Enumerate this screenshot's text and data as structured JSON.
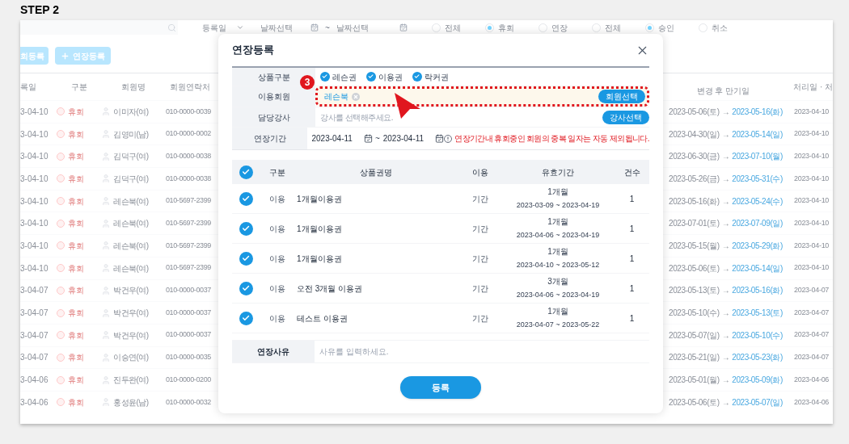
{
  "heading": "STEP 2",
  "background": {
    "filter": {
      "date_type": "등록일",
      "date_from": "날짜선택",
      "separator": "~",
      "date_to": "날짜선택"
    },
    "radio_groups": [
      [
        {
          "label": "전체",
          "selected": false
        },
        {
          "label": "휴회",
          "selected": true
        },
        {
          "label": "연장",
          "selected": false
        }
      ],
      [
        {
          "label": "전체",
          "selected": false
        },
        {
          "label": "승인",
          "selected": true
        },
        {
          "label": "취소",
          "selected": false
        }
      ]
    ],
    "actions": [
      {
        "kind": "plain",
        "label": "회등록"
      },
      {
        "kind": "add",
        "label": "연장등록"
      }
    ],
    "columns_left": [
      "록일",
      "구분",
      "회원명",
      "회원연락처"
    ],
    "columns_right": [
      "변경 후 만기일",
      "처리일 · 처"
    ],
    "rows": [
      {
        "date": "3-04-10",
        "status": "휴회",
        "name": "이미자",
        "gender": "(여)",
        "phone": "010-0000-0039",
        "before": "2023-05-06(토)",
        "arrow": "→",
        "after": "2023-05-16(화)",
        "processed": "2023-04-10"
      },
      {
        "date": "3-04-10",
        "status": "휴회",
        "name": "김영미",
        "gender": "(남)",
        "phone": "010-0000-0002",
        "before": "2023-04-30(일)",
        "arrow": "→",
        "after": "2023-05-14(일)",
        "processed": "2023-04-10"
      },
      {
        "date": "3-04-10",
        "status": "휴회",
        "name": "김덕구",
        "gender": "(여)",
        "phone": "010-0000-0038",
        "before": "2023-06-30(금)",
        "arrow": "→",
        "after": "2023-07-10(월)",
        "processed": "2023-04-10"
      },
      {
        "date": "3-04-10",
        "status": "휴회",
        "name": "김덕구",
        "gender": "(여)",
        "phone": "010-0000-0038",
        "before": "2023-05-26(금)",
        "arrow": "→",
        "after": "2023-05-31(수)",
        "processed": "2023-04-10"
      },
      {
        "date": "3-04-10",
        "status": "휴회",
        "name": "레슨북",
        "gender": "(여)",
        "phone": "010-5697-2399",
        "before": "2023-05-16(화)",
        "arrow": "→",
        "after": "2023-05-24(수)",
        "processed": "2023-04-10"
      },
      {
        "date": "3-04-10",
        "status": "휴회",
        "name": "레슨북",
        "gender": "(여)",
        "phone": "010-5697-2399",
        "before": "2023-07-01(토)",
        "arrow": "→",
        "after": "2023-07-09(일)",
        "processed": "2023-04-10"
      },
      {
        "date": "3-04-10",
        "status": "휴회",
        "name": "레슨북",
        "gender": "(여)",
        "phone": "010-5697-2399",
        "before": "2023-05-15(월)",
        "arrow": "→",
        "after": "2023-05-29(화)",
        "processed": "2023-04-10"
      },
      {
        "date": "3-04-10",
        "status": "휴회",
        "name": "레슨북",
        "gender": "(여)",
        "phone": "010-5697-2399",
        "before": "2023-05-06(토)",
        "arrow": "→",
        "after": "2023-05-14(일)",
        "processed": "2023-04-10"
      },
      {
        "date": "3-04-07",
        "status": "휴회",
        "name": "박건우",
        "gender": "(여)",
        "phone": "010-0000-0037",
        "before": "2023-05-13(토)",
        "arrow": "→",
        "after": "2023-05-16(화)",
        "processed": "2023-04-07"
      },
      {
        "date": "3-04-07",
        "status": "휴회",
        "name": "박건우",
        "gender": "(여)",
        "phone": "010-0000-0037",
        "before": "2023-05-10(수)",
        "arrow": "→",
        "after": "2023-05-13(토)",
        "processed": "2023-04-07"
      },
      {
        "date": "3-04-07",
        "status": "휴회",
        "name": "박건우",
        "gender": "(여)",
        "phone": "010-0000-0037",
        "before": "2023-05-07(일)",
        "arrow": "→",
        "after": "2023-05-10(수)",
        "processed": "2023-04-07"
      },
      {
        "date": "3-04-07",
        "status": "휴회",
        "name": "이승연",
        "gender": "(여)",
        "phone": "010-0000-0035",
        "before": "2023-05-21(일)",
        "arrow": "→",
        "after": "2023-05-23(화)",
        "processed": "2023-04-07"
      },
      {
        "date": "3-04-06",
        "status": "휴회",
        "name": "진두완",
        "gender": "(여)",
        "phone": "010-0000-0200",
        "before": "2023-05-01(월)",
        "arrow": "→",
        "after": "2023-05-09(화)",
        "processed": "2023-04-06"
      },
      {
        "date": "3-04-06",
        "status": "휴회",
        "name": "홍성윤",
        "gender": "(남)",
        "phone": "010-0000-0032",
        "before": "2023-05-06(토)",
        "arrow": "→",
        "after": "2023-05-07(일)",
        "processed": "2023-04-06"
      }
    ]
  },
  "modal": {
    "title": "연장등록",
    "product_type": {
      "label": "상품구분",
      "options": [
        {
          "label": "레슨권",
          "checked": true
        },
        {
          "label": "이용권",
          "checked": true
        },
        {
          "label": "락커권",
          "checked": true
        }
      ]
    },
    "member": {
      "label": "이용회원",
      "chip": "레슨북",
      "button": "회원선택",
      "highlighted": true
    },
    "instructor": {
      "label": "담당강사",
      "placeholder": "강사를 선택해주세요.",
      "button": "강사선택"
    },
    "period": {
      "label": "연장기간",
      "from": "2023-04-11",
      "separator": "~",
      "to": "2023-04-11",
      "note": "연장기간내 휴회중인 회원의 중복 일자는 자동 제외됩니다."
    },
    "table": {
      "all_checked": true,
      "columns": [
        "구분",
        "상품권명",
        "이용",
        "유효기간",
        "건수"
      ],
      "rows": [
        {
          "checked": true,
          "type": "이용",
          "name": "1개월이용권",
          "usage": "기간",
          "duration": "1개월",
          "range": "2023-03-09 ~ 2023-04-19",
          "count": "1"
        },
        {
          "checked": true,
          "type": "이용",
          "name": "1개월이용권",
          "usage": "기간",
          "duration": "1개월",
          "range": "2023-04-06 ~ 2023-04-19",
          "count": "1"
        },
        {
          "checked": true,
          "type": "이용",
          "name": "1개월이용권",
          "usage": "기간",
          "duration": "1개월",
          "range": "2023-04-10 ~ 2023-05-12",
          "count": "1"
        },
        {
          "checked": true,
          "type": "이용",
          "name": "오전 3개월 이용권",
          "usage": "기간",
          "duration": "3개월",
          "range": "2023-04-06 ~ 2023-04-19",
          "count": "1"
        },
        {
          "checked": true,
          "type": "이용",
          "name": "테스트 이용권",
          "usage": "기간",
          "duration": "1개월",
          "range": "2023-04-07 ~ 2023-05-22",
          "count": "1"
        }
      ]
    },
    "reason": {
      "label": "연장사유",
      "placeholder": "사유를 입력하세요."
    },
    "submit": "등록"
  },
  "callout": {
    "number": "3"
  }
}
